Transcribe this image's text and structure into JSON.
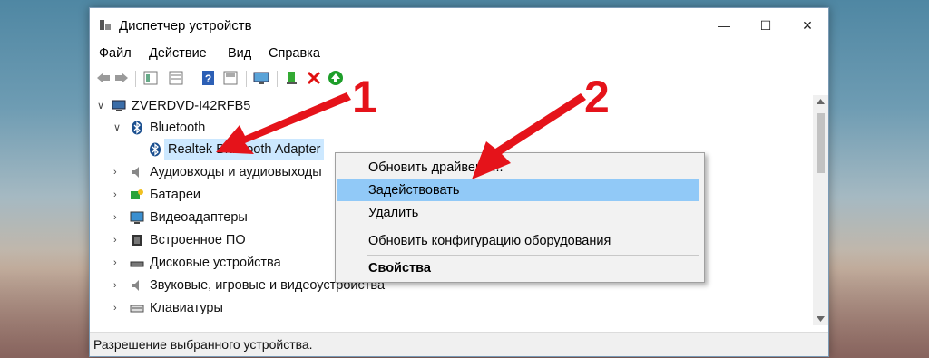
{
  "window": {
    "title": "Диспетчер устройств",
    "controls": [
      "—",
      "☐",
      "✕"
    ]
  },
  "menu": [
    "Файл",
    "Действие",
    "Вид",
    "Справка"
  ],
  "toolbar": {
    "icons": [
      "back-icon",
      "forward-icon",
      "properties-icon",
      "view-icon",
      "help-icon",
      "view2-icon",
      "monitor-icon",
      "update-driver-icon",
      "remove-icon",
      "enable-icon"
    ]
  },
  "tree": {
    "root": "ZVERDVD-I42RFB5",
    "bluetooth": "Bluetooth",
    "bluetooth_child": "Realtek Bluetooth Adapter",
    "items": [
      "Аудиовходы и аудиовыходы",
      "Батареи",
      "Видеоадаптеры",
      "Встроенное ПО",
      "Дисковые устройства",
      "Звуковые, игровые и видеоустройства",
      "Клавиатуры"
    ]
  },
  "context_menu": {
    "update_driver": "Обновить драйверы...",
    "enable": "Задействовать",
    "remove": "Удалить",
    "scan": "Обновить конфигурацию оборудования",
    "properties": "Свойства"
  },
  "status": "Разрешение выбранного устройства.",
  "annotations": {
    "one": "1",
    "two": "2"
  },
  "colors": {
    "highlight": "#91c9f7",
    "selected": "#cce8ff",
    "arrow": "#e5131a"
  }
}
